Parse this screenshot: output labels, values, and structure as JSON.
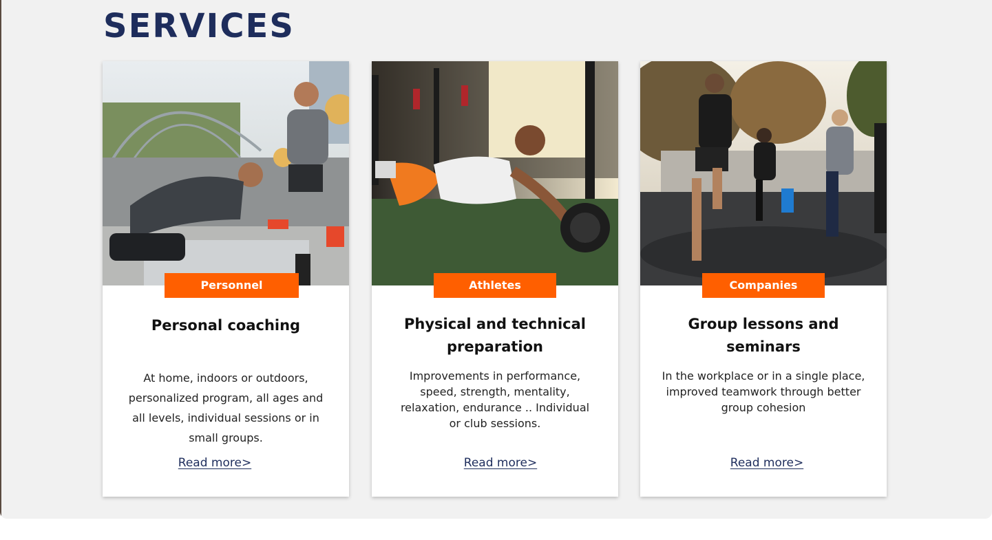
{
  "section": {
    "title": "SERVICES"
  },
  "colors": {
    "accent": "#ff5f00",
    "title": "#1e2d5c",
    "panel_background": "#f1f1f1"
  },
  "cards": [
    {
      "badge": "Personnel",
      "title": "Personal coaching",
      "description": "At home, indoors or outdoors, personalized program, all ages and all levels, individual sessions or in small groups.",
      "link": "Read more>",
      "image": "photo-personal-coaching"
    },
    {
      "badge": "Athletes",
      "title": "Physical and technical preparation",
      "description": "Improvements in performance, speed, strength, mentality, relaxation, endurance .. Individual or club sessions.",
      "link": "Read more>",
      "image": "photo-athlete-ab-roller"
    },
    {
      "badge": "Companies",
      "title": "Group lessons and seminars",
      "description": "In the workplace or in a single place, improved teamwork through better group cohesion",
      "link": "Read more>",
      "image": "photo-group-training"
    }
  ]
}
